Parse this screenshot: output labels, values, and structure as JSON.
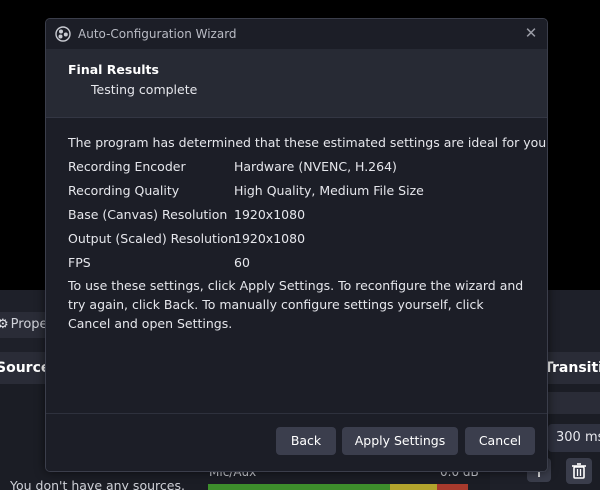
{
  "background": {
    "properties_tab_label": "Prope",
    "sources_header": "Sources",
    "no_sources_text": "You don't have any sources.",
    "transitions_header": "Transiti...",
    "duration_value": "300 ms",
    "mixer_channel_label": "Mic/Aux",
    "mixer_channel_level": "0.0 dB"
  },
  "dialog": {
    "title": "Auto-Configuration Wizard",
    "header": {
      "title": "Final Results",
      "subtitle": "Testing complete"
    },
    "intro": "The program has determined that these estimated settings are ideal for you:",
    "settings": [
      {
        "label": "Recording Encoder",
        "value": "Hardware (NVENC, H.264)"
      },
      {
        "label": "Recording Quality",
        "value": "High Quality, Medium File Size"
      },
      {
        "label": "Base (Canvas) Resolution",
        "value": "1920x1080"
      },
      {
        "label": "Output (Scaled) Resolution",
        "value": "1920x1080"
      },
      {
        "label": "FPS",
        "value": "60"
      }
    ],
    "instructions": "To use these settings, click Apply Settings. To reconfigure the wizard and try again, click Back. To manually configure settings yourself, click Cancel and open Settings.",
    "buttons": {
      "back": "Back",
      "apply": "Apply Settings",
      "cancel": "Cancel"
    }
  },
  "colors": {
    "dialog_bg": "#1c1e27",
    "header_bg": "#272a34",
    "button_bg": "#3b3e4d"
  }
}
